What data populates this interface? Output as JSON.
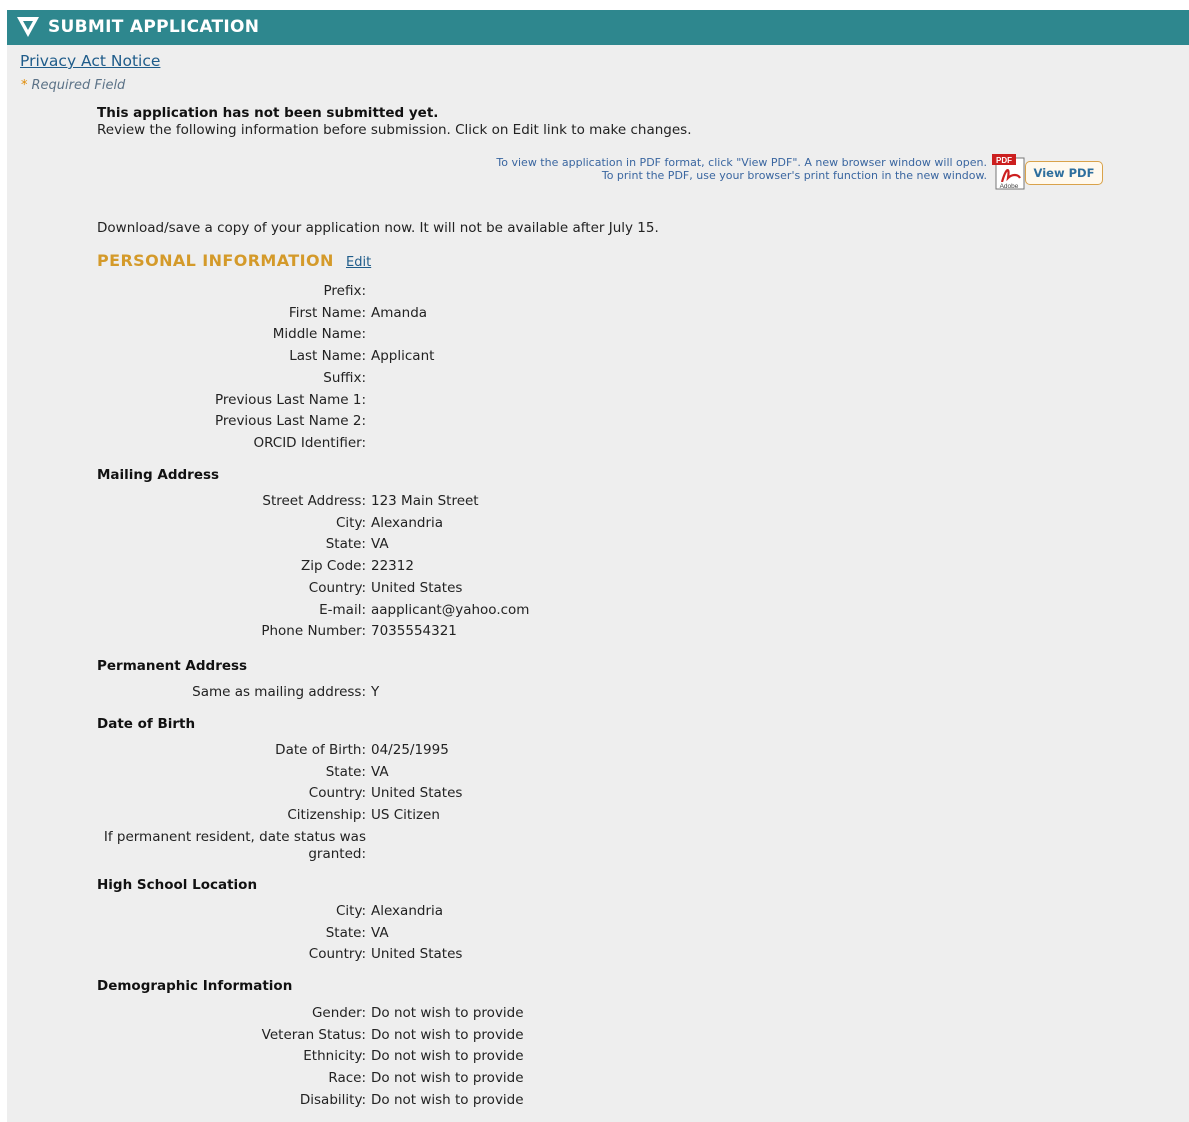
{
  "header": {
    "title": "SUBMIT APPLICATION"
  },
  "privacy_link": "Privacy Act Notice",
  "required_note": "Required Field",
  "required_marker": "*",
  "notice": {
    "bold": "This application has not been submitted yet.",
    "text": "Review the following information before submission. Click on Edit link to make changes."
  },
  "pdf": {
    "note_line1": "To view the application in PDF format, click \"View PDF\". A new browser window will open.",
    "note_line2": "To print the PDF, use your browser's print function in the new window.",
    "icon_top": "PDF",
    "icon_bottom": "Adobe",
    "button_label": "View PDF"
  },
  "download_text": "Download/save a copy of your application now. It will not be available after July 15.",
  "personal": {
    "title": "PERSONAL INFORMATION",
    "edit_label": "Edit",
    "fields": [
      {
        "label": "Prefix:",
        "value": ""
      },
      {
        "label": "First Name:",
        "value": "Amanda"
      },
      {
        "label": "Middle Name:",
        "value": ""
      },
      {
        "label": "Last Name:",
        "value": "Applicant"
      },
      {
        "label": "Suffix:",
        "value": ""
      },
      {
        "label": "Previous Last Name 1:",
        "value": ""
      },
      {
        "label": "Previous Last Name 2:",
        "value": ""
      },
      {
        "label": "ORCID Identifier:",
        "value": ""
      }
    ]
  },
  "mailing": {
    "heading": "Mailing Address",
    "fields": [
      {
        "label": "Street Address:",
        "value": "123 Main Street"
      },
      {
        "label": "City:",
        "value": "Alexandria"
      },
      {
        "label": "State:",
        "value": "VA"
      },
      {
        "label": "Zip Code:",
        "value": "22312"
      },
      {
        "label": "Country:",
        "value": "United States"
      },
      {
        "label": "E-mail:",
        "value": "aapplicant@yahoo.com"
      },
      {
        "label": "Phone Number:",
        "value": "7035554321"
      }
    ]
  },
  "permanent": {
    "heading": "Permanent Address",
    "fields": [
      {
        "label": "Same as mailing address:",
        "value": "Y"
      }
    ]
  },
  "dob": {
    "heading": "Date of Birth",
    "fields": [
      {
        "label": "Date of Birth:",
        "value": "04/25/1995"
      },
      {
        "label": "State:",
        "value": "VA"
      },
      {
        "label": "Country:",
        "value": "United States"
      },
      {
        "label": "Citizenship:",
        "value": "US Citizen"
      }
    ],
    "resident_label": "If permanent resident, date status was granted:",
    "resident_value": ""
  },
  "highschool": {
    "heading": "High School Location",
    "fields": [
      {
        "label": "City:",
        "value": "Alexandria"
      },
      {
        "label": "State:",
        "value": "VA"
      },
      {
        "label": "Country:",
        "value": "United States"
      }
    ]
  },
  "demographic": {
    "heading": "Demographic Information",
    "fields": [
      {
        "label": "Gender:",
        "value": "Do not wish to provide"
      },
      {
        "label": "Veteran Status:",
        "value": "Do not wish to provide"
      },
      {
        "label": "Ethnicity:",
        "value": "Do not wish to provide"
      },
      {
        "label": "Race:",
        "value": "Do not wish to provide"
      },
      {
        "label": "Disability:",
        "value": "Do not wish to provide"
      }
    ]
  },
  "colors": {
    "header_bg": "#2e878e",
    "section_title": "#d49a2a",
    "link": "#1f5c8a",
    "panel_bg": "#eeeeee"
  }
}
